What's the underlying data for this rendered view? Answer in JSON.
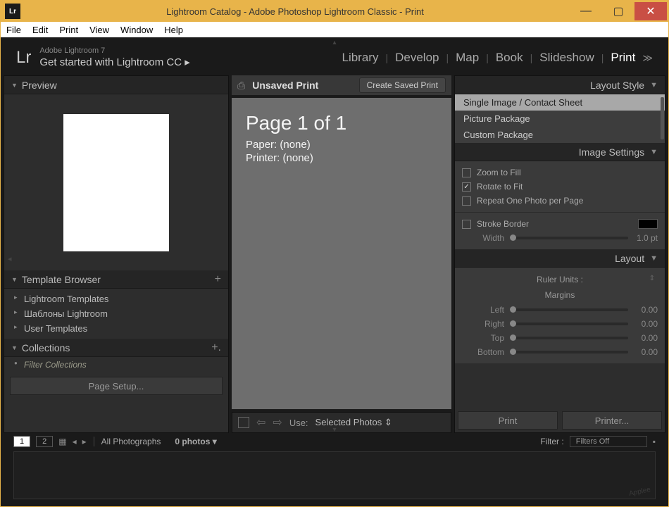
{
  "window": {
    "title": "Lightroom Catalog - Adobe Photoshop Lightroom Classic - Print"
  },
  "menubar": [
    "File",
    "Edit",
    "Print",
    "View",
    "Window",
    "Help"
  ],
  "brand": {
    "line1": "Adobe Lightroom 7",
    "line2": "Get started with Lightroom CC ▸"
  },
  "modules": [
    "Library",
    "Develop",
    "Map",
    "Book",
    "Slideshow",
    "Print"
  ],
  "active_module": "Print",
  "left": {
    "preview_label": "Preview",
    "template_label": "Template Browser",
    "templates": [
      "Lightroom Templates",
      "Шаблоны Lightroom",
      "User Templates"
    ],
    "collections_label": "Collections",
    "filter_placeholder": "Filter Collections",
    "page_setup": "Page Setup..."
  },
  "center": {
    "unsaved": "Unsaved Print",
    "create_saved": "Create Saved Print",
    "page_info": "Page 1 of 1",
    "paper": "Paper: (none)",
    "printer": "Printer: (none)",
    "use_label": "Use:",
    "use_value": "Selected Photos"
  },
  "right": {
    "layout_style_label": "Layout Style",
    "styles": [
      "Single Image / Contact Sheet",
      "Picture Package",
      "Custom Package"
    ],
    "image_settings_label": "Image Settings",
    "zoom_fill": "Zoom to Fill",
    "rotate_fit": "Rotate to Fit",
    "repeat": "Repeat One Photo per Page",
    "stroke": "Stroke Border",
    "width_label": "Width",
    "width_val": "1.0 pt",
    "layout_label": "Layout",
    "ruler": "Ruler Units :",
    "margins_label": "Margins",
    "margins": [
      {
        "label": "Left",
        "val": "0.00"
      },
      {
        "label": "Right",
        "val": "0.00"
      },
      {
        "label": "Top",
        "val": "0.00"
      },
      {
        "label": "Bottom",
        "val": "0.00"
      }
    ],
    "print_btn": "Print",
    "printer_btn": "Printer..."
  },
  "footer": {
    "all_photos": "All Photographs",
    "count": "0 photos",
    "filter_label": "Filter :",
    "filter_value": "Filters Off"
  }
}
